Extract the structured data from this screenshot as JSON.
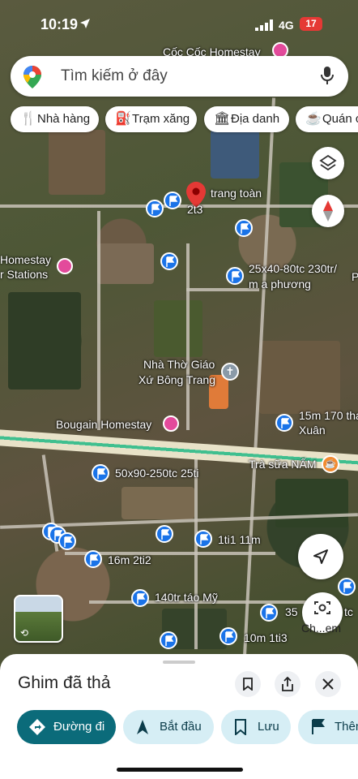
{
  "status": {
    "time": "10:19",
    "network": "4G",
    "battery": "17"
  },
  "search": {
    "placeholder": "Tìm kiếm ở đây"
  },
  "chips": [
    {
      "icon": "fork-knife-icon",
      "label": "Nhà hàng"
    },
    {
      "icon": "gas-station-icon",
      "label": "Trạm xăng"
    },
    {
      "icon": "landmark-icon",
      "label": "Địa danh"
    },
    {
      "icon": "coffee-icon",
      "label": "Quán c"
    }
  ],
  "map_labels": {
    "coc_coc": "Cốc Cốc Homestay",
    "pin_name_1": "trang toàn",
    "pin_name_2": "2t3",
    "homestay_left_1": "Homestay",
    "homestay_left_2": "r Stations",
    "listing_1a": "25x40-80tc 230tr/",
    "listing_1b": "m a phương",
    "listing_p": "P",
    "church_1": "Nhà Thờ Giáo",
    "church_2": "Xứ Bông Trang",
    "bougain": "Bougain Homestay",
    "listing_2a": "15m 170 tha",
    "listing_2b": "Xuân",
    "tea": "Trà sữa NẤM",
    "listing_3": "50x90-250tc 25ti",
    "listing_4": "1ti1 11m",
    "listing_5": "16m 2ti2",
    "listing_6": "140tr táo Mỹ",
    "listing_7": "35",
    "listing_7b": "tc",
    "listing_8": "10m 1ti3",
    "camera_label": "Ch...em"
  },
  "sheet": {
    "title": "Ghim đã thả",
    "actions": [
      {
        "label": "Đường đi"
      },
      {
        "label": "Bắt đầu"
      },
      {
        "label": "Lưu"
      },
      {
        "label": "Thêm"
      }
    ]
  },
  "colors": {
    "accent": "#0b6b7a",
    "pin_blue": "#1a73e8",
    "pin_red": "#e53935",
    "lodging": "#e34a9b"
  }
}
